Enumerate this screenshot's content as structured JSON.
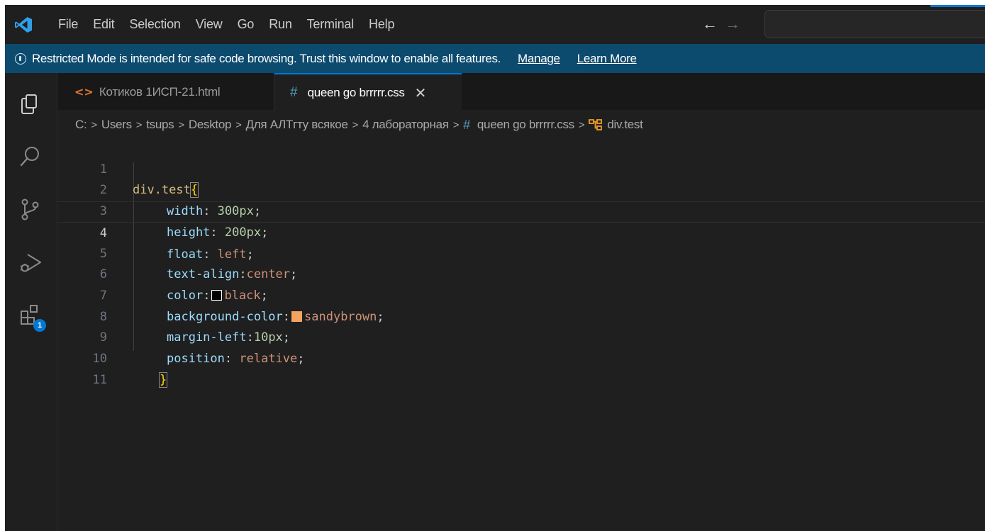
{
  "menu": [
    "File",
    "Edit",
    "Selection",
    "View",
    "Go",
    "Run",
    "Terminal",
    "Help"
  ],
  "nav": {
    "back": "←",
    "forward": "→"
  },
  "banner": {
    "text": "Restricted Mode is intended for safe code browsing. Trust this window to enable all features.",
    "manage": "Manage",
    "learn_more": "Learn More"
  },
  "activity": {
    "extensions_badge": "1"
  },
  "tabs": [
    {
      "icon": "<>",
      "label": "Котиков 1ИСП-21.html"
    },
    {
      "icon": "#",
      "label": "queen go brrrrr.css",
      "close": "✕"
    }
  ],
  "breadcrumb": {
    "items": [
      "C:",
      "Users",
      "tsups",
      "Desktop",
      "Для АЛТгту всякое",
      "4 лабораторная"
    ],
    "file_icon": "#",
    "file": "queen go brrrrr.css",
    "symbol": "div.test",
    "separator": ">"
  },
  "editor": {
    "line_numbers": [
      "1",
      "2",
      "3",
      "4",
      "5",
      "6",
      "7",
      "8",
      "9",
      "10",
      "11"
    ],
    "active_line": 4,
    "selector": "div.test",
    "open_brace": "{",
    "close_brace": "}",
    "lines": [
      {
        "prop": "width",
        "sep": ": ",
        "value": "300px",
        "end": ";"
      },
      {
        "prop": "height",
        "sep": ": ",
        "value": "200px",
        "end": ";"
      },
      {
        "prop": "float",
        "sep": ": ",
        "value": "left",
        "end": ";"
      },
      {
        "prop": "text-align",
        "sep": ":",
        "value": "center",
        "end": ";"
      },
      {
        "prop": "color",
        "sep": ":",
        "value": "black",
        "end": ";",
        "swatch": "#000000"
      },
      {
        "prop": "background-color",
        "sep": ":",
        "value": "sandybrown",
        "end": ";",
        "swatch": "#f4a460"
      },
      {
        "prop": "margin-left",
        "sep": ":",
        "value": "10px",
        "end": ";"
      },
      {
        "prop": "position",
        "sep": ": ",
        "value": "relative",
        "end": ";"
      }
    ]
  },
  "colors": {
    "accent": "#0078d4",
    "banner_bg": "#0c4a6e",
    "editor_bg": "#1f1f1f"
  }
}
